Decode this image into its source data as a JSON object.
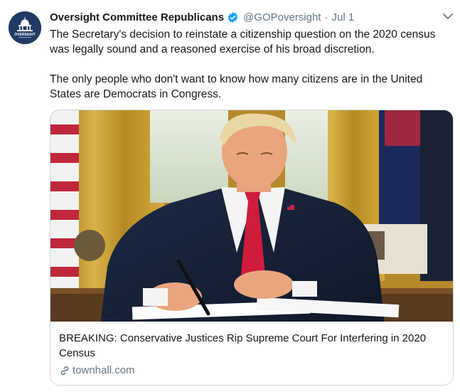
{
  "tweet": {
    "display_name": "Oversight Committee Republicans",
    "handle": "@GOPoversight",
    "separator": "·",
    "date": "Jul 1",
    "paragraphs": [
      "The Secretary's decision to reinstate a citizenship question on the 2020 census was legally sound and a reasoned exercise of his broad discretion.",
      "The only people who don't want to know how many citizens are in the United States are Democrats in Congress."
    ]
  },
  "avatar": {
    "logo_text": "OVERSIGHT"
  },
  "card": {
    "title": "BREAKING: Conservative Justices Rip Supreme Court For Interfering in 2020 Census",
    "domain": "townhall.com"
  },
  "colors": {
    "verified": "#1da1f2",
    "secondary_text": "#657786",
    "avatar_bg": "#1f3b63"
  }
}
